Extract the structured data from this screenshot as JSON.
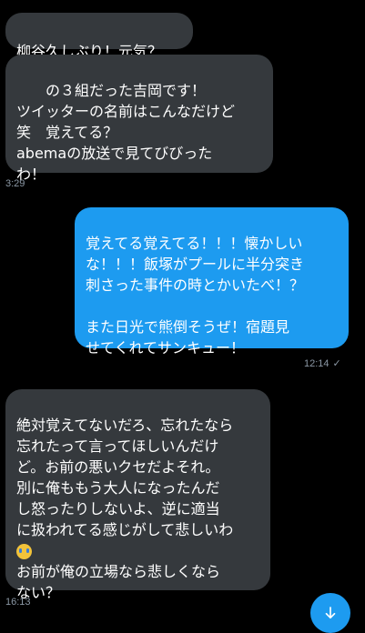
{
  "messages": [
    {
      "text": "柳谷久しぶり！元気？"
    },
    {
      "text": "　　の３組だった吉岡です！\nツイッターの名前はこんなだけど\n笑　覚えてる？\nabemaの放送で見てびびった\nわ！",
      "time": "3:29"
    },
    {
      "text": "覚えてる覚えてる！！！懐かしい\nな！！！飯塚がプールに半分突き\n刺さった事件の時とかいたべ！？\n\nまた日光で熊倒そうぜ！宿題見\nせてくれてサンキュー！",
      "time": "12:14"
    },
    {
      "text_before_emoji": "絶対覚えてないだろ、忘れたなら\n忘れたって言ってほしいんだけ\nど。お前の悪いクセだよそれ。\n別に俺ももう大人になったんだ\nし怒ったりしないよ、逆に適当\nに扱われてる感じがして悲しいわ",
      "emoji": "crying-face-emoji",
      "text_after_emoji": "お前が俺の立場なら悲しくなら\nない？",
      "time": "16:13"
    }
  ],
  "icons": {
    "read_receipt": "✓",
    "scroll_down": "arrow-down-icon"
  },
  "colors": {
    "background": "#000000",
    "incoming_bubble": "#35393d",
    "outgoing_bubble": "#1d9bf0",
    "timestamp": "#8b98a5"
  }
}
